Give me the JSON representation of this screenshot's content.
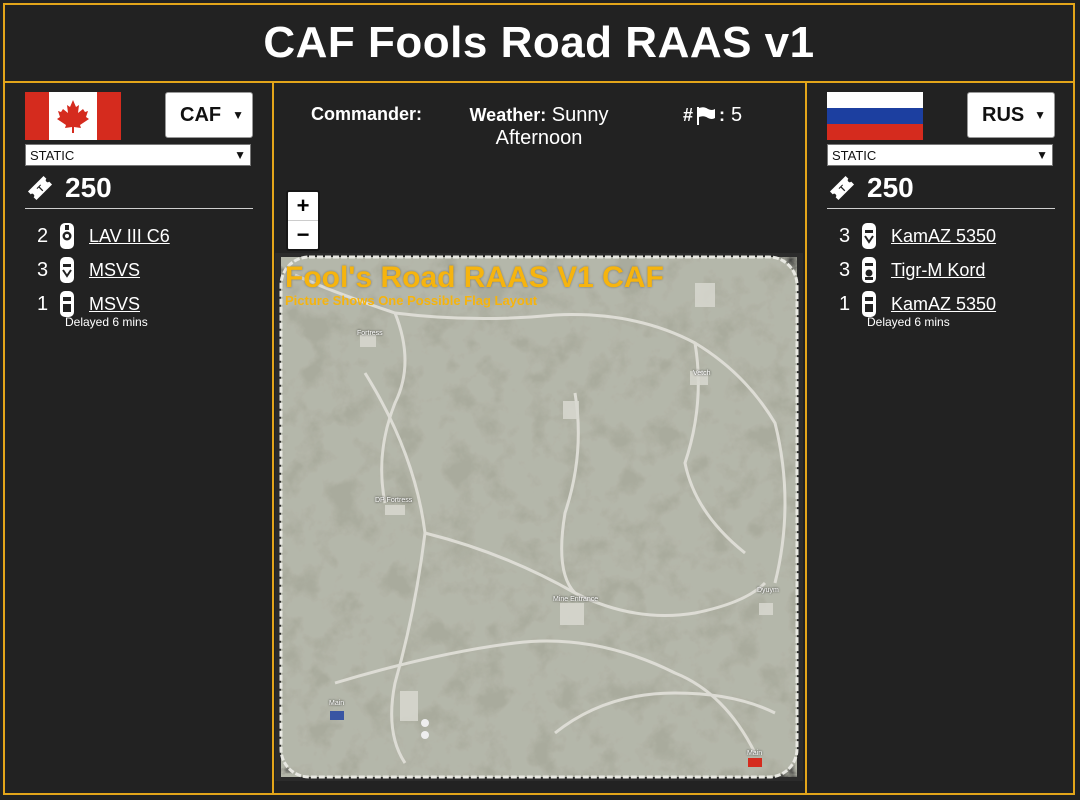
{
  "header": {
    "title": "CAF Fools Road RAAS v1"
  },
  "info": {
    "commander_label": "Commander:",
    "weather_label": "Weather:",
    "weather_value": "Sunny",
    "weather_value2": "Afternoon",
    "flags_label_hash": "#",
    "flags_colon": ":",
    "flags_count": "5"
  },
  "zoom": {
    "in": "+",
    "out": "−"
  },
  "team_left": {
    "team": "CAF",
    "mode": "STATIC",
    "tickets": "250",
    "vehicles": [
      {
        "count": "2",
        "name": "LAV III C6"
      },
      {
        "count": "3",
        "name": "MSVS"
      },
      {
        "count": "1",
        "name": "MSVS"
      }
    ],
    "delay_note": "Delayed 6 mins"
  },
  "team_right": {
    "team": "RUS",
    "mode": "STATIC",
    "tickets": "250",
    "vehicles": [
      {
        "count": "3",
        "name": "KamAZ 5350"
      },
      {
        "count": "3",
        "name": "Tigr-M Kord"
      },
      {
        "count": "1",
        "name": "KamAZ 5350"
      }
    ],
    "delay_note": "Delayed 6 mins"
  },
  "map": {
    "title": "Fool's Road RAAS V1 CAF",
    "subtitle": "Picture Shows One Possible Flag Layout",
    "pois": {
      "fortress": "Fortress",
      "vetch": "Vetch",
      "dp_fortress": "DP Fortress",
      "mine_entrance": "Mine Entrance",
      "dyuym": "Dyuym",
      "main_left": "Main",
      "main_right": "Main"
    }
  },
  "colors": {
    "accent": "#e3a51a",
    "background": "#222222",
    "map_title": "#f6b40e"
  }
}
